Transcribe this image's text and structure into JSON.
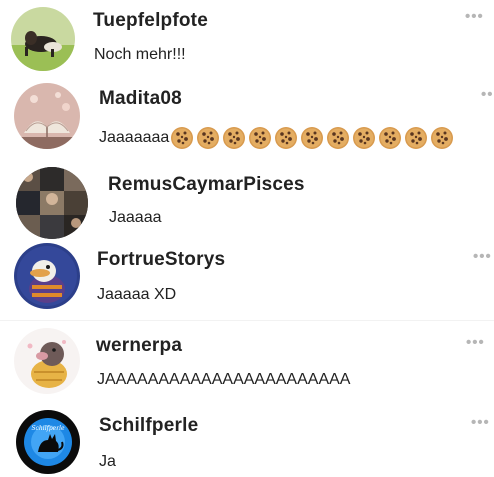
{
  "comments": [
    {
      "username": "Tuepfelpfote",
      "text": "Noch mehr!!!",
      "avatar_icon": "dog-photo-icon"
    },
    {
      "username": "Madita08",
      "text": "Jaaaaaaa",
      "emoji_count": 11,
      "emoji_icon": "cookie-icon",
      "avatar_icon": "open-book-photo-icon"
    },
    {
      "username": "RemusCaymarPisces",
      "text": "Jaaaaa",
      "avatar_icon": "photo-collage-icon"
    },
    {
      "username": "FortrueStorys",
      "text": "Jaaaaa XD",
      "avatar_icon": "platypus-cartoon-icon"
    },
    {
      "username": "wernerpa",
      "text": "JAAAAAAAAAAAAAAAAAAAAAAA",
      "avatar_icon": "mole-cartoon-icon"
    },
    {
      "username": "Schilfperle",
      "text": "Ja",
      "avatar_icon": "cat-silhouette-icon"
    }
  ],
  "more_label": "•••",
  "colors": {
    "text": "#222222",
    "more": "#b6b6b6",
    "background": "#ffffff"
  }
}
